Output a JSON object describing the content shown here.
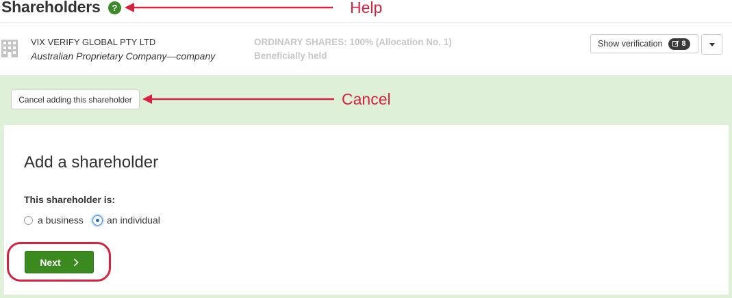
{
  "header": {
    "title": "Shareholders",
    "help_icon": "question-circle-icon",
    "help_annotation": "Help"
  },
  "shareholder": {
    "icon": "building-icon",
    "name": "VIX VERIFY GLOBAL PTY LTD",
    "type": "Australian Proprietary Company—company",
    "shares": "ORDINARY SHARES: 100% (Allocation No. 1)",
    "holding": "Beneficially held",
    "verify_button": "Show verification",
    "verify_count": "8",
    "verify_icon": "edit-check-icon",
    "dropdown_icon": "caret-down-icon"
  },
  "panel": {
    "cancel_button": "Cancel adding this shareholder",
    "cancel_annotation": "Cancel",
    "title": "Add a shareholder",
    "question": "This shareholder is:",
    "options": [
      {
        "label": "a business",
        "selected": false
      },
      {
        "label": "an individual",
        "selected": true
      }
    ],
    "next_button": "Next",
    "next_icon": "chevron-right-icon"
  },
  "colors": {
    "annotation": "#d6223e",
    "panel_bg": "#dff0d8",
    "primary_green": "#3b8a1f",
    "help_green": "#3a8a2a"
  }
}
